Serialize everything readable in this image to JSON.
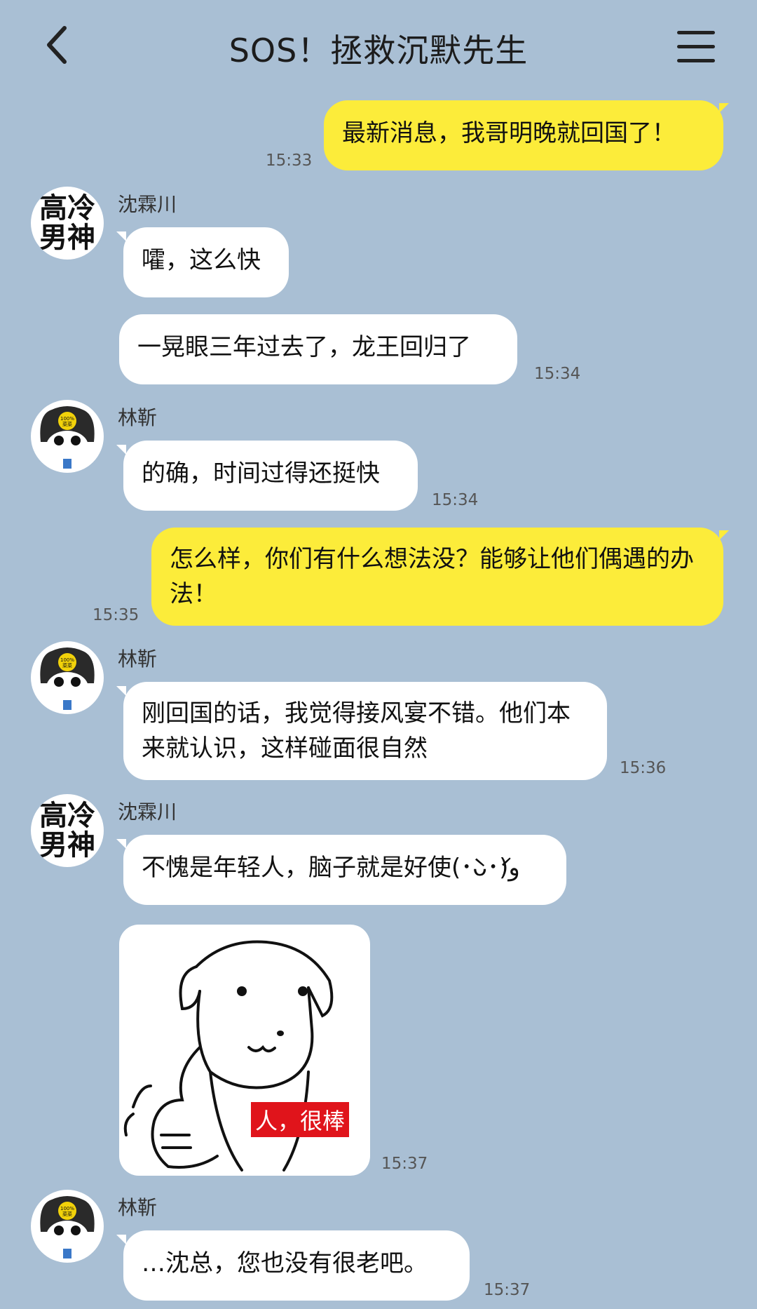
{
  "header": {
    "title": "SOS！拯救沉默先生"
  },
  "avatars": {
    "shen_text": "高冷男神",
    "lin_badge": "100%\n菜菜"
  },
  "messages": [
    {
      "side": "right",
      "text": "最新消息，我哥明晚就回国了！",
      "time": "15:33"
    },
    {
      "side": "left",
      "sender": "沈霖川",
      "text": "嚯，这么快"
    },
    {
      "side": "left",
      "text": "一晃眼三年过去了，龙王回归了",
      "time": "15:34"
    },
    {
      "side": "left",
      "sender": "林靳",
      "text": "的确，时间过得还挺快",
      "time": "15:34"
    },
    {
      "side": "right",
      "text": "怎么样，你们有什么想法没？能够让他们偶遇的办法！",
      "time": "15:35"
    },
    {
      "side": "left",
      "sender": "林靳",
      "text": "刚回国的话，我觉得接风宴不错。他们本来就认识，这样碰面很自然",
      "time": "15:36"
    },
    {
      "side": "left",
      "sender": "沈霖川",
      "text": "不愧是年轻人，脑子就是好使(･̀ᴗ･́)و"
    },
    {
      "side": "left",
      "sticker": true,
      "caption": "人，很棒",
      "time": "15:37"
    },
    {
      "side": "left",
      "sender": "林靳",
      "text": "…沈总，您也没有很老吧。",
      "time": "15:37"
    }
  ]
}
